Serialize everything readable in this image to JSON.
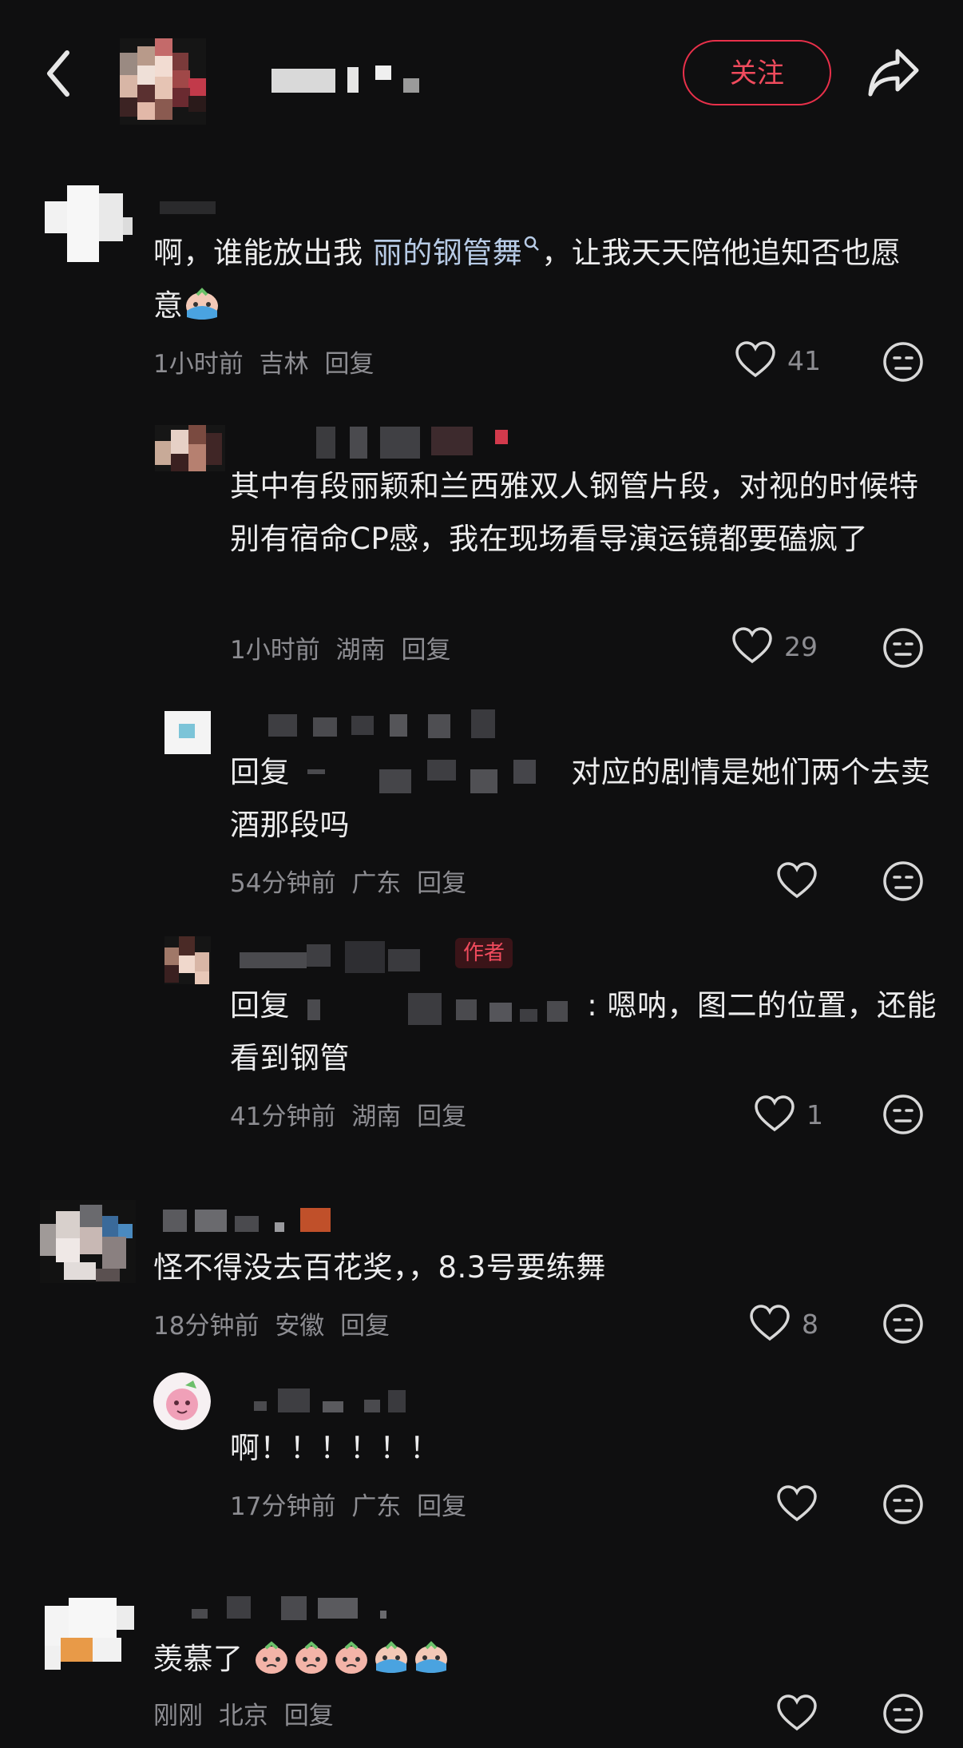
{
  "header": {
    "follow_label": "关注"
  },
  "comments": [
    {
      "text": "啊，谁能放出我",
      "link": "丽的钢管舞",
      "text_after": "，让我天天陪他追知否也愿意",
      "time": "1小时前",
      "location": "吉林",
      "reply_label": "回复",
      "likes": "41"
    },
    {
      "text": "其中有段丽颖和兰西雅双人钢管片段，对视的时候特别有宿命CP感，我在现场看导演运镜都要磕疯了",
      "time": "1小时前",
      "location": "湖南",
      "reply_label": "回复",
      "likes": "29"
    },
    {
      "reply_prefix": "回复",
      "text": "对应的剧情是她们两个去卖酒那段吗",
      "time": "54分钟前",
      "location": "广东",
      "reply_label": "回复",
      "likes": ""
    },
    {
      "author_tag": "作者",
      "reply_prefix": "回复",
      "text": ": 嗯呐，图二的位置，还能看到钢管",
      "time": "41分钟前",
      "location": "湖南",
      "reply_label": "回复",
      "likes": "1"
    },
    {
      "text": "怪不得没去百花奖，，8.3号要练舞",
      "time": "18分钟前",
      "location": "安徽",
      "reply_label": "回复",
      "likes": "8"
    },
    {
      "text": "啊！！！！！！",
      "time": "17分钟前",
      "location": "广东",
      "reply_label": "回复",
      "likes": ""
    },
    {
      "text": "羡慕了",
      "time": "刚刚",
      "location": "北京",
      "reply_label": "回复",
      "likes": ""
    }
  ],
  "icons": {
    "back": "chevron-left-icon",
    "share": "share-arrow-icon",
    "like": "heart-outline-icon",
    "dislike": "meh-face-icon",
    "emoji_cry": "crying-face-emoji",
    "emoji_peach": "peach-face-emoji"
  },
  "colors": {
    "background": "#0f0f10",
    "accent": "#f04b5d",
    "text": "#ececed",
    "meta": "#8d8d92",
    "link": "#b7cbe6"
  }
}
